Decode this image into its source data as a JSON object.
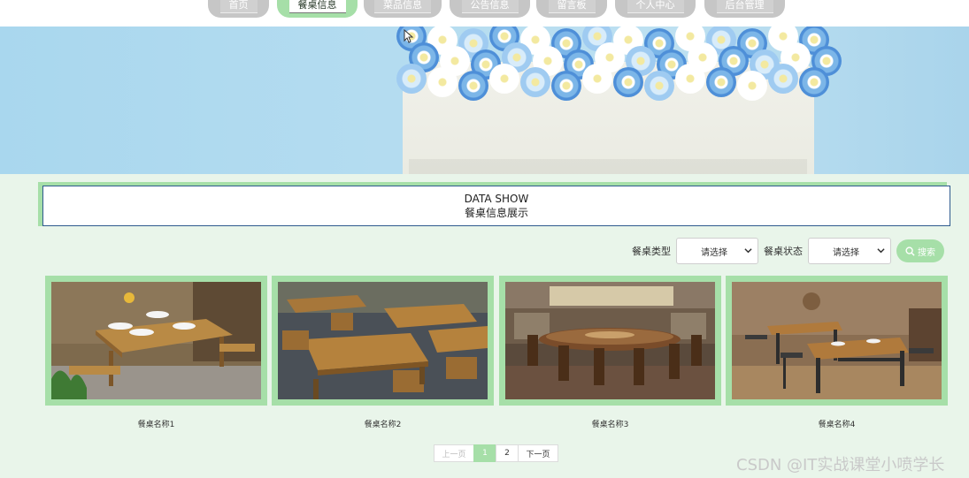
{
  "nav": {
    "items": [
      {
        "label": "首页"
      },
      {
        "label": "餐桌信息"
      },
      {
        "label": "菜品信息"
      },
      {
        "label": "公告信息"
      },
      {
        "label": "留言板"
      },
      {
        "label": "个人中心"
      },
      {
        "label": "后台管理"
      }
    ],
    "active_index": 1
  },
  "section": {
    "title_en": "DATA SHOW",
    "title_cn": "餐桌信息展示"
  },
  "filters": {
    "type_label": "餐桌类型",
    "type_value": "请选择",
    "status_label": "餐桌状态",
    "status_value": "请选择",
    "search_label": "搜索"
  },
  "cards": [
    {
      "name": "餐桌名称1"
    },
    {
      "name": "餐桌名称2"
    },
    {
      "name": "餐桌名称3"
    },
    {
      "name": "餐桌名称4"
    }
  ],
  "pagination": {
    "prev": "上一页",
    "pages": [
      "1",
      "2"
    ],
    "current": "1",
    "next": "下一页"
  },
  "watermark": "CSDN @IT实战课堂小喷学长",
  "colors": {
    "accent": "#a6dfa8",
    "nav_inactive": "#c6c6c6",
    "page_bg": "#e9f5ea",
    "title_border": "#2e5a8e"
  }
}
